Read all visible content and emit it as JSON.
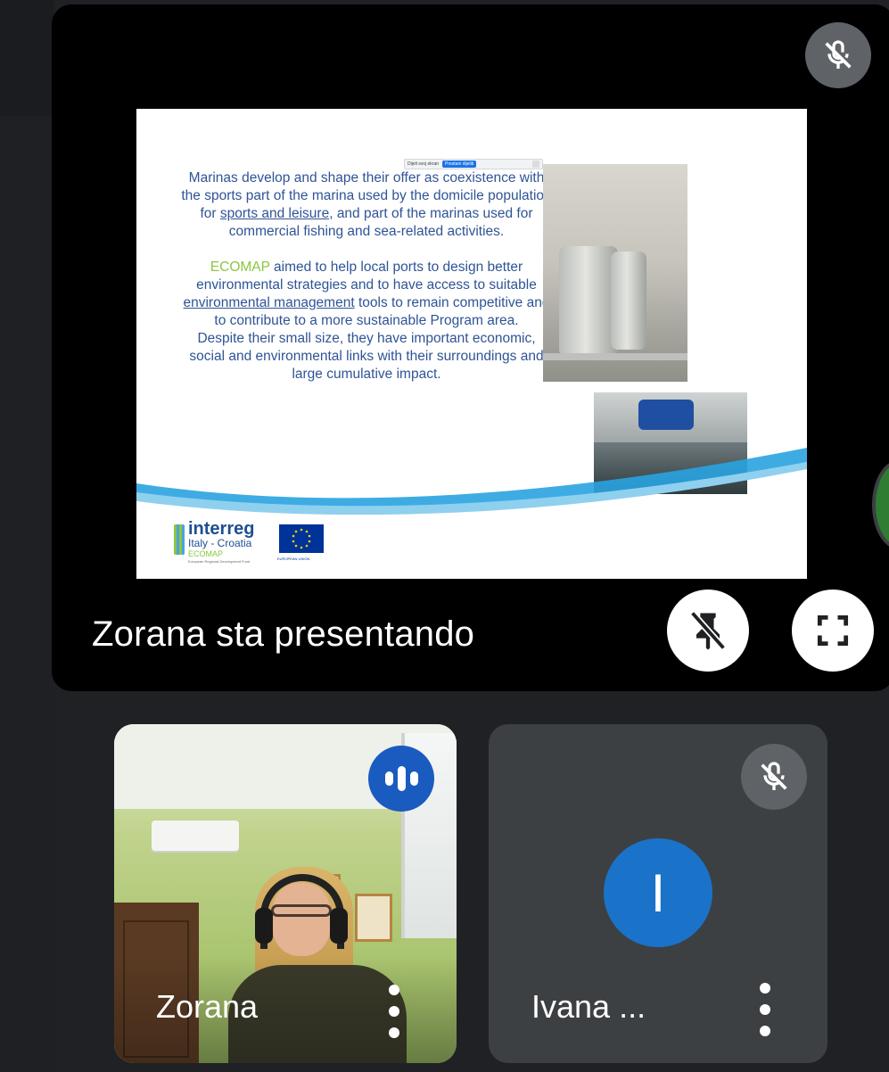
{
  "presentation": {
    "presenting_label": "Zorana sta presentando",
    "mic_icon": "mic-off-icon",
    "pin_icon": "unpin-icon",
    "fullscreen_icon": "fullscreen-icon",
    "slide": {
      "share_bar_text": "Dijeli svoj ekran",
      "share_bar_button": "Prestani dijeliti",
      "paragraph1_a": "Marinas develop and shape their offer as coexistence with the sports part of the marina used by the domicile population for ",
      "paragraph1_link1": "sports and leisure",
      "paragraph1_b": ", and part of the marinas used for commercial fishing and sea-related activities.",
      "paragraph2_brand": "ECOMAP",
      "paragraph2_a": " aimed to help local ports to design better environmental strategies and to have access to suitable ",
      "paragraph2_link": "environmental management",
      "paragraph2_b": " tools to remain competitive and to contribute to a more sustainable Program area.",
      "paragraph3": "Despite their small size, they have important economic, social and environmental links with their surroundings and large cumulative impact.",
      "logo_brand": "interreg",
      "logo_region": "Italy - Croatia",
      "logo_project": "ECOMAP",
      "logo_fund": "European Regional Development Fund",
      "eu_label": "EUROPEAN UNION"
    }
  },
  "participants": [
    {
      "name": "Zorana",
      "status_icon": "speaking-icon",
      "more_icon": "more-vert-icon"
    },
    {
      "name": "Ivana ...",
      "avatar_letter": "I",
      "status_icon": "mic-off-icon",
      "more_icon": "more-vert-icon"
    }
  ],
  "colors": {
    "background": "#202124",
    "tile_dark": "#3c4043",
    "speaking_blue": "#1a5bbf",
    "avatar_blue": "#1a73c8",
    "slide_text": "#2f5496",
    "ecomap_green": "#8cc63f"
  }
}
